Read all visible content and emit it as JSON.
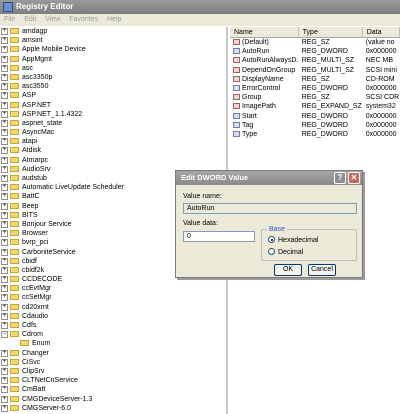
{
  "window": {
    "title": "Registry Editor"
  },
  "menu": [
    "File",
    "Edit",
    "View",
    "Favorites",
    "Help"
  ],
  "tree": [
    {
      "label": "amdagp",
      "expander": "+"
    },
    {
      "label": "amsint",
      "expander": "+"
    },
    {
      "label": "Apple Mobile Device",
      "expander": "+"
    },
    {
      "label": "AppMgmt",
      "expander": "+"
    },
    {
      "label": "asc",
      "expander": "+"
    },
    {
      "label": "asc3350p",
      "expander": "+"
    },
    {
      "label": "asc3550",
      "expander": "+"
    },
    {
      "label": "ASP",
      "expander": "+"
    },
    {
      "label": "ASP.NET",
      "expander": "+"
    },
    {
      "label": "ASP.NET_1.1.4322",
      "expander": "+"
    },
    {
      "label": "aspnet_state",
      "expander": "+"
    },
    {
      "label": "AsyncMac",
      "expander": "+"
    },
    {
      "label": "atapi",
      "expander": "+"
    },
    {
      "label": "Atdisk",
      "expander": "+"
    },
    {
      "label": "Atmarpc",
      "expander": "+"
    },
    {
      "label": "AudioSrv",
      "expander": "+"
    },
    {
      "label": "audstub",
      "expander": "+"
    },
    {
      "label": "Automatic LiveUpdate Scheduler",
      "expander": "+"
    },
    {
      "label": "BattC",
      "expander": "+"
    },
    {
      "label": "Beep",
      "expander": "+"
    },
    {
      "label": "BITS",
      "expander": "+"
    },
    {
      "label": "Bonjour Service",
      "expander": "+"
    },
    {
      "label": "Browser",
      "expander": "+"
    },
    {
      "label": "bvrp_pci",
      "expander": "+"
    },
    {
      "label": "CarboniteService",
      "expander": "+"
    },
    {
      "label": "cbidf",
      "expander": "+"
    },
    {
      "label": "cbidf2k",
      "expander": "+"
    },
    {
      "label": "CCDECODE",
      "expander": "+"
    },
    {
      "label": "ccEvtMgr",
      "expander": "+"
    },
    {
      "label": "ccSetMgr",
      "expander": "+"
    },
    {
      "label": "cd20xrnt",
      "expander": "+"
    },
    {
      "label": "Cdaudio",
      "expander": "+"
    },
    {
      "label": "Cdfs",
      "expander": "+"
    },
    {
      "label": "Cdrom",
      "expander": "−"
    },
    {
      "label": "Enum",
      "expander": "",
      "child": true
    },
    {
      "label": "Changer",
      "expander": "+"
    },
    {
      "label": "CiSvc",
      "expander": "+"
    },
    {
      "label": "ClipSrv",
      "expander": "+"
    },
    {
      "label": "CLTNetCnService",
      "expander": "+"
    },
    {
      "label": "CmBatt",
      "expander": "+"
    },
    {
      "label": "CMGDeviceServer-1.3",
      "expander": "+"
    },
    {
      "label": "CMGServer-6.0",
      "expander": "+"
    }
  ],
  "list": {
    "headers": {
      "name": "Name",
      "type": "Type",
      "data": "Data"
    },
    "rows": [
      {
        "name": "(Default)",
        "type": "REG_SZ",
        "data": "(value no",
        "icon": "string-value-icon"
      },
      {
        "name": "AutoRun",
        "type": "REG_DWORD",
        "data": "0x000000",
        "icon": "binary-value-icon"
      },
      {
        "name": "AutoRunAlwaysD...",
        "type": "REG_MULTI_SZ",
        "data": "NEC  MB",
        "icon": "string-value-icon"
      },
      {
        "name": "DependOnGroup",
        "type": "REG_MULTI_SZ",
        "data": "SCSI mini",
        "icon": "string-value-icon"
      },
      {
        "name": "DisplayName",
        "type": "REG_SZ",
        "data": "CD-ROM",
        "icon": "string-value-icon"
      },
      {
        "name": "ErrorControl",
        "type": "REG_DWORD",
        "data": "0x000000",
        "icon": "binary-value-icon"
      },
      {
        "name": "Group",
        "type": "REG_SZ",
        "data": "SCSI CDR",
        "icon": "string-value-icon"
      },
      {
        "name": "ImagePath",
        "type": "REG_EXPAND_SZ",
        "data": "system32",
        "icon": "string-value-icon"
      },
      {
        "name": "Start",
        "type": "REG_DWORD",
        "data": "0x000000",
        "icon": "binary-value-icon"
      },
      {
        "name": "Tag",
        "type": "REG_DWORD",
        "data": "0x000000",
        "icon": "binary-value-icon"
      },
      {
        "name": "Type",
        "type": "REG_DWORD",
        "data": "0x000000",
        "icon": "binary-value-icon"
      }
    ]
  },
  "dialog": {
    "title": "Edit DWORD Value",
    "help_glyph": "?",
    "close_glyph": "✕",
    "value_name_label": "Value name:",
    "value_name": "AutoRun",
    "value_data_label": "Value data:",
    "value_data": "0",
    "base_label": "Base",
    "hex_label": "Hexadecimal",
    "dec_label": "Decimal",
    "base_selected": "Hexadecimal",
    "ok_label": "OK",
    "cancel_label": "Cancel"
  }
}
